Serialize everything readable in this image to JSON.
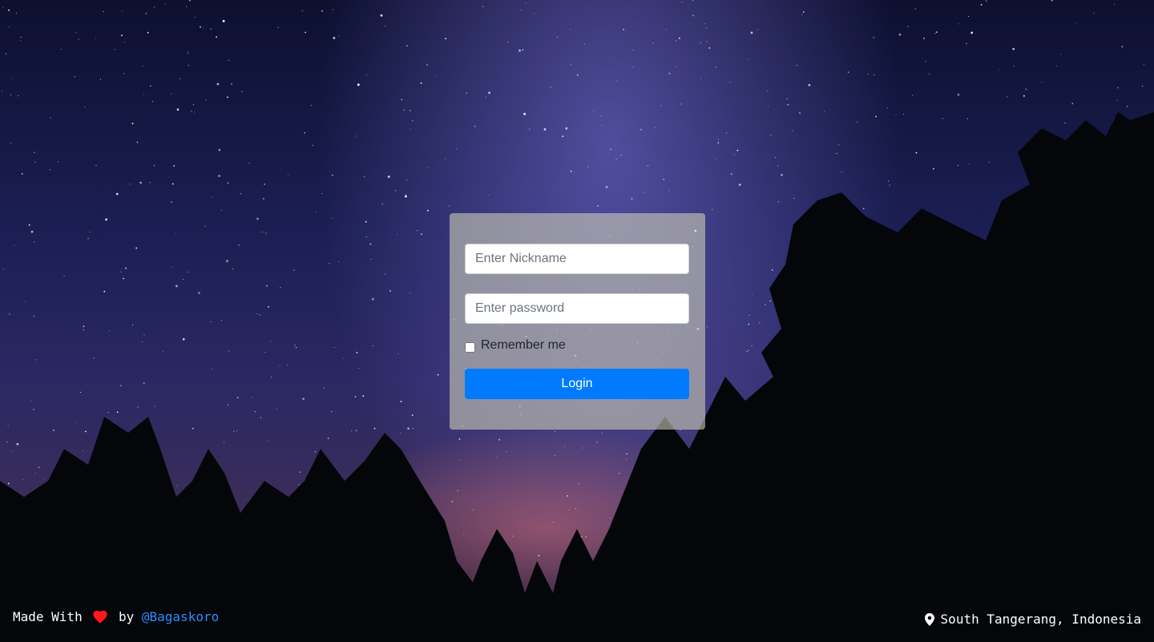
{
  "login": {
    "nickname_placeholder": "Enter Nickname",
    "password_placeholder": "Enter password",
    "remember_label": "Remember me",
    "login_label": "Login"
  },
  "footer": {
    "made_with": "Made With",
    "heart_icon": "heart-icon",
    "by": "by",
    "author": "@Bagaskoro",
    "location_icon": "map-marker-icon",
    "location": "South Tangerang, Indonesia"
  },
  "colors": {
    "primary_button": "#007bff",
    "link": "#2f8cff",
    "heart": "#ff1a1a"
  }
}
